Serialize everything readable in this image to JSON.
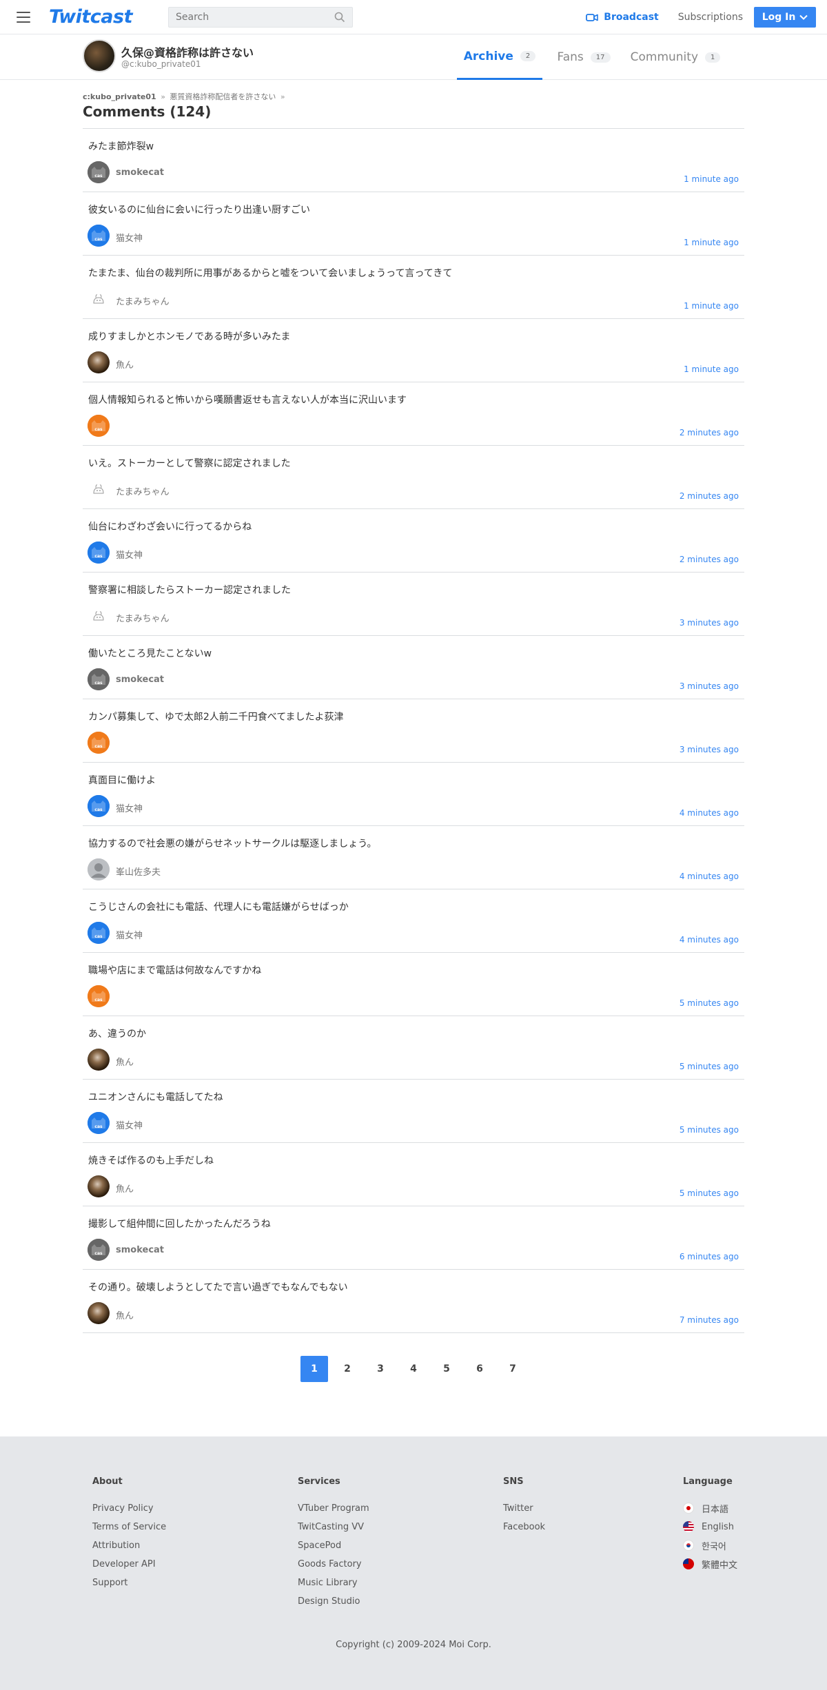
{
  "header": {
    "logo": "Twitcast",
    "search_placeholder": "Search",
    "broadcast_label": "Broadcast",
    "subscriptions_label": "Subscriptions",
    "login_label": "Log In"
  },
  "profile": {
    "name": "久保@資格詐称は許さない",
    "id": "@c:kubo_private01",
    "tabs": [
      {
        "label": "Archive",
        "count": "2",
        "active": true
      },
      {
        "label": "Fans",
        "count": "17",
        "active": false
      },
      {
        "label": "Community",
        "count": "1",
        "active": false
      }
    ]
  },
  "breadcrumb": {
    "first": "c:kubo_private01",
    "second": "悪質資格詐称配信者を許さない"
  },
  "comments_title": "Comments (124)",
  "comments": [
    {
      "text": "みたま節炸裂w",
      "user": "smokecat",
      "avatar": "smoke",
      "time": "1 minute ago"
    },
    {
      "text": "彼女いるのに仙台に会いに行ったり出逢い厨すごい",
      "user": "猫女神",
      "avatar": "cat",
      "time": "1 minute ago"
    },
    {
      "text": "たまたま、仙台の裁判所に用事があるからと嘘をついて会いましょうって言ってきて",
      "user": "たまみちゃん",
      "avatar": "tama",
      "time": "1 minute ago"
    },
    {
      "text": "成りすましかとホンモノである時が多いみたま",
      "user": "魚ん",
      "avatar": "fish",
      "time": "1 minute ago"
    },
    {
      "text": "個人情報知られると怖いから嘆願書返せも言えない人が本当に沢山います",
      "user": "",
      "avatar": "orange",
      "time": "2 minutes ago"
    },
    {
      "text": "いえ。ストーカーとして警察に認定されました",
      "user": "たまみちゃん",
      "avatar": "tama",
      "time": "2 minutes ago"
    },
    {
      "text": "仙台にわざわざ会いに行ってるからね",
      "user": "猫女神",
      "avatar": "cat",
      "time": "2 minutes ago"
    },
    {
      "text": "警察署に相談したらストーカー認定されました",
      "user": "たまみちゃん",
      "avatar": "tama",
      "time": "3 minutes ago"
    },
    {
      "text": "働いたところ見たことないw",
      "user": "smokecat",
      "avatar": "smoke",
      "time": "3 minutes ago"
    },
    {
      "text": "カンパ募集して、ゆで太郎2人前二千円食べてましたよ荻津",
      "user": "",
      "avatar": "orange",
      "time": "3 minutes ago"
    },
    {
      "text": "真面目に働けよ",
      "user": "猫女神",
      "avatar": "cat",
      "time": "4 minutes ago"
    },
    {
      "text": "協力するので社会悪の嫌がらせネットサークルは駆逐しましょう。",
      "user": "峯山佐多夫",
      "avatar": "gray",
      "time": "4 minutes ago"
    },
    {
      "text": "こうじさんの会社にも電話、代理人にも電話嫌がらせばっか",
      "user": "猫女神",
      "avatar": "cat",
      "time": "4 minutes ago"
    },
    {
      "text": "職場や店にまで電話は何故なんですかね",
      "user": "",
      "avatar": "orange",
      "time": "5 minutes ago"
    },
    {
      "text": "あ、違うのか",
      "user": "魚ん",
      "avatar": "fish",
      "time": "5 minutes ago"
    },
    {
      "text": "ユニオンさんにも電話してたね",
      "user": "猫女神",
      "avatar": "cat",
      "time": "5 minutes ago"
    },
    {
      "text": "焼きそば作るのも上手だしね",
      "user": "魚ん",
      "avatar": "fish",
      "time": "5 minutes ago"
    },
    {
      "text": "撮影して組仲間に回したかったんだろうね",
      "user": "smokecat",
      "avatar": "smoke",
      "time": "6 minutes ago"
    },
    {
      "text": "その通り。破壊しようとしてたで言い過ぎでもなんでもない",
      "user": "魚ん",
      "avatar": "fish",
      "time": "7 minutes ago"
    }
  ],
  "pagination": [
    "1",
    "2",
    "3",
    "4",
    "5",
    "6",
    "7"
  ],
  "footer": {
    "about": {
      "heading": "About",
      "links": [
        "Privacy Policy",
        "Terms of Service",
        "Attribution",
        "Developer API",
        "Support"
      ]
    },
    "services": {
      "heading": "Services",
      "links": [
        "VTuber Program",
        "TwitCasting VV",
        "SpacePod",
        "Goods Factory",
        "Music Library",
        "Design Studio"
      ]
    },
    "sns": {
      "heading": "SNS",
      "links": [
        "Twitter",
        "Facebook"
      ]
    },
    "language": {
      "heading": "Language",
      "links": [
        "日本語",
        "English",
        "한국어",
        "繁體中文"
      ]
    },
    "copyright": "Copyright (c) 2009-2024 Moi Corp."
  },
  "colors": {
    "accent": "#3586f2",
    "brand": "#1f7ae8",
    "footer_bg": "#e5e7ea"
  },
  "icons": [
    "hamburger-icon",
    "search-icon",
    "video-camera-icon",
    "chevron-down-icon",
    "cat-face-icon"
  ]
}
